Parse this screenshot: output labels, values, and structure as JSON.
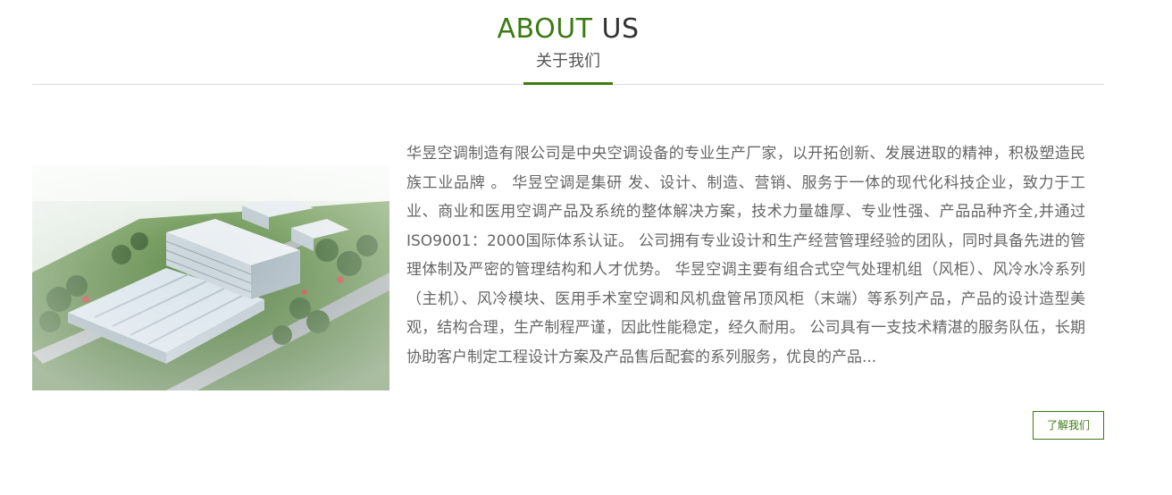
{
  "section": {
    "title_green": "ABOUT",
    "title_dark": "US",
    "subtitle": "关于我们"
  },
  "about": {
    "description": "华昱空调制造有限公司是中央空调设备的专业生产厂家，以开拓创新、发展进取的精神，积极塑造民族工业品牌 。 华昱空调是集研 发、设计、制造、营销、服务于一体的现代化科技企业，致力于工业、商业和医用空调产品及系统的整体解决方案，技术力量雄厚、专业性强、产品品种齐全,并通过ISO9001：2000国际体系认证。 公司拥有专业设计和生产经营管理经验的团队，同时具备先进的管理体制及严密的管理结构和人才优势。 华昱空调主要有组合式空气处理机组（风柜）、风冷水冷系列（主机）、风冷模块、医用手术室空调和风机盘管吊顶风柜（末端）等系列产品，产品的设计造型美观，结构合理，生产制程严谨，因此性能稳定，经久耐用。 公司具有一支技术精湛的服务队伍，长期协助客户制定工程设计方案及产品售后配套的系列服务，优良的产品...",
    "more_button": "了解我们"
  },
  "colors": {
    "accent": "#3c7a12",
    "title_dark": "#333333",
    "body_text": "#666666",
    "divider": "#dddddd"
  }
}
